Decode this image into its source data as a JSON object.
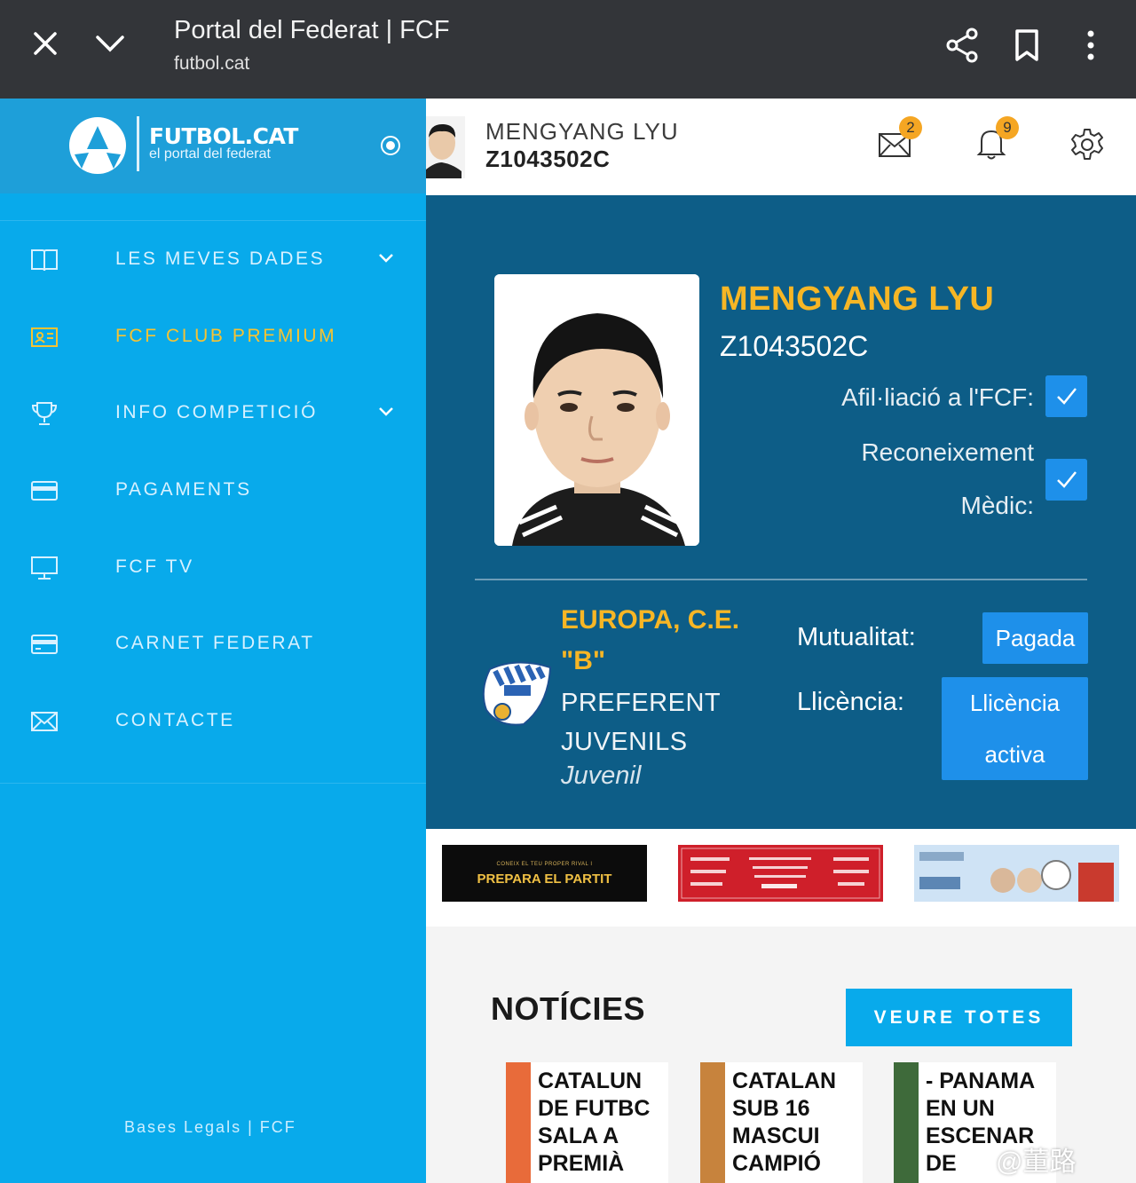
{
  "browser": {
    "title": "Portal del Federat | FCF",
    "url": "futbol.cat"
  },
  "sidebar": {
    "logo_title": "FUTBOL.CAT",
    "logo_subtitle": "el portal del federat",
    "items": [
      {
        "label": "LES MEVES DADES",
        "icon": "book-icon",
        "has_dropdown": true
      },
      {
        "label": "FCF CLUB PREMIUM",
        "icon": "id-card-icon",
        "has_dropdown": false,
        "accent": "#f7c332"
      },
      {
        "label": "INFO COMPETICIÓ",
        "icon": "trophy-icon",
        "has_dropdown": true
      },
      {
        "label": "PAGAMENTS",
        "icon": "credit-card-icon",
        "has_dropdown": false
      },
      {
        "label": "FCF TV",
        "icon": "monitor-icon",
        "has_dropdown": false
      },
      {
        "label": "CARNET FEDERAT",
        "icon": "card-icon",
        "has_dropdown": false
      },
      {
        "label": "CONTACTE",
        "icon": "mail-icon",
        "has_dropdown": false
      }
    ],
    "footer": "Bases Legals | FCF"
  },
  "user": {
    "name": "MENGYANG LYU",
    "id": "Z1043502C",
    "mail_count": "2",
    "notif_count": "9"
  },
  "profile": {
    "name": "MENGYANG LYU",
    "id": "Z1043502C",
    "afiliacio_label": "Afil·liació a l'FCF:",
    "reconeixement_line1": "Reconeixement",
    "reconeixement_line2": "Mèdic:",
    "club_line1": "EUROPA, C.E.",
    "club_line2": "\"B\"",
    "category_line1": "PREFERENT",
    "category_line2": "JUVENILS",
    "category_type": "Juvenil",
    "mutualitat_label": "Mutualitat:",
    "mutualitat_value": "Pagada",
    "llicencia_label": "Llicència:",
    "llicencia_line1": "Llicència",
    "llicencia_line2": "activa"
  },
  "ads": {
    "ad1_small": "CONEIX EL TEU PROPER RIVAL I",
    "ad1_big": "PREPARA EL PARTIT"
  },
  "news": {
    "title": "NOTÍCIES",
    "see_all": "VEURE TOTES",
    "cards": [
      {
        "lines": [
          "CATALUN",
          "DE FUTBC",
          "SALA A",
          "PREMIÀ"
        ]
      },
      {
        "lines": [
          "CATALAN",
          "SUB 16",
          "MASCUI",
          "CAMPIÓ"
        ]
      },
      {
        "lines": [
          "- PANAMA",
          "EN UN",
          "ESCENAR",
          "DE"
        ]
      }
    ]
  },
  "watermark": "@董路",
  "colors": {
    "sidebar": "#08aaeb",
    "card": "#0d5d87",
    "accent_yellow": "#f7b625",
    "button_blue": "#1e90ea"
  }
}
